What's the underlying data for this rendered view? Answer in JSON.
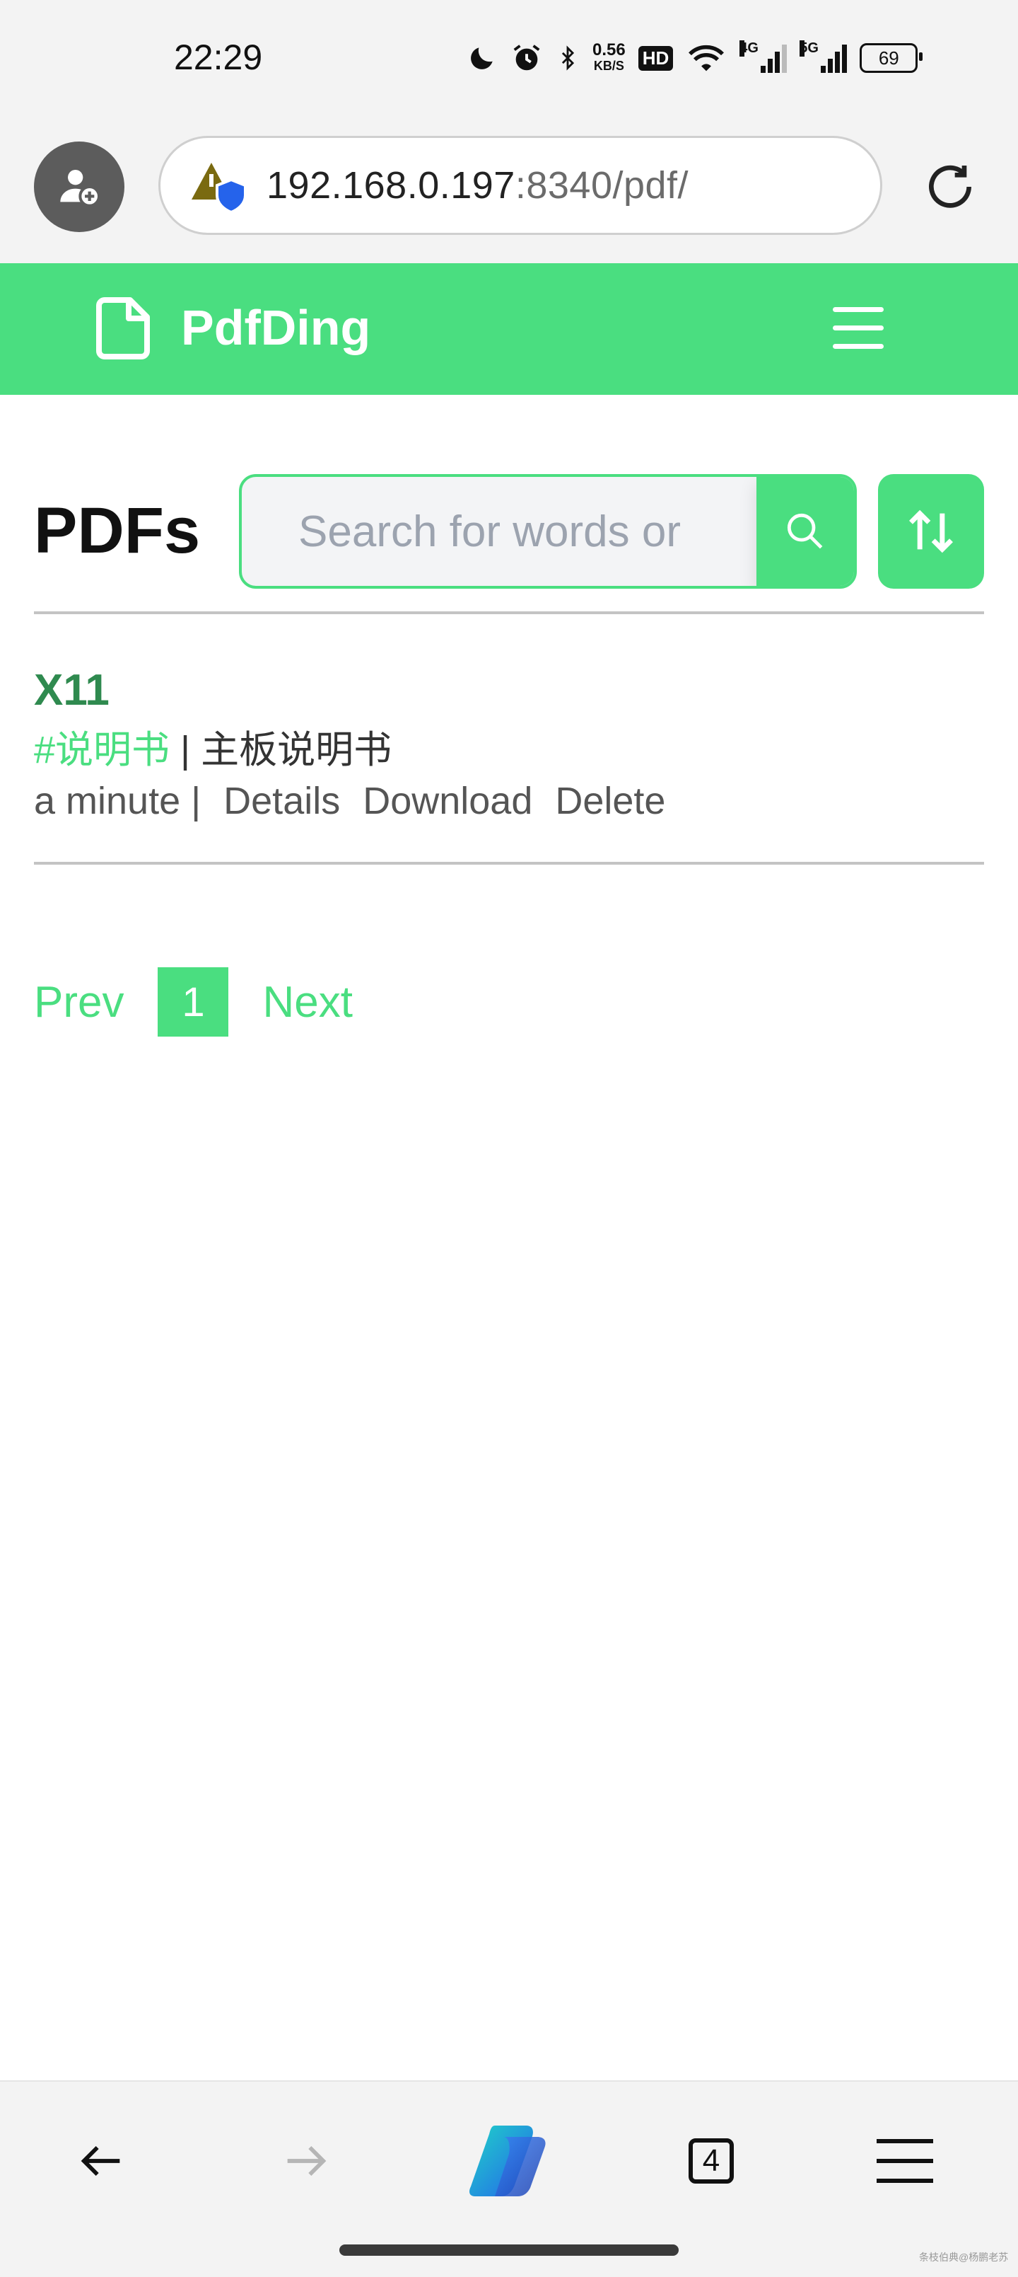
{
  "status_bar": {
    "time": "22:29",
    "net_speed_value": "0.56",
    "net_speed_unit": "KB/S",
    "hd_badge": "HD",
    "signal_1_label": "4G",
    "signal_2_label": "5G",
    "battery": "69",
    "icons": [
      "moon-icon",
      "alarm-icon",
      "bluetooth-icon",
      "wifi-icon"
    ]
  },
  "browser": {
    "url_host": "192.168.0.197",
    "url_rest": ":8340/pdf/",
    "tabs_count": "4"
  },
  "app": {
    "brand": "PdfDing",
    "accent": "#4ade80",
    "accent_dark": "#2f8a4f"
  },
  "page": {
    "title": "PDFs",
    "search_placeholder": "Search for words or"
  },
  "pdfs": [
    {
      "name": "X11",
      "tag": "#说明书",
      "separator": " | ",
      "description": "主板说明书",
      "time": "a minute |",
      "actions": [
        "Details",
        "Download",
        "Delete"
      ]
    }
  ],
  "pagination": {
    "prev": "Prev",
    "current": "1",
    "next": "Next"
  },
  "watermark": "条枝伯典@杨鹏老苏"
}
